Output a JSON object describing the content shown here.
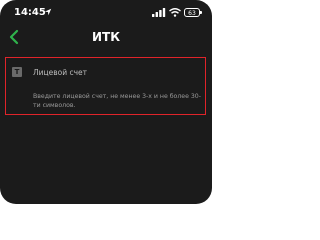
{
  "status_bar": {
    "time": "14:45",
    "battery": "63"
  },
  "header": {
    "title": "ИТК"
  },
  "form": {
    "account_field": {
      "placeholder": "Лицевой счет",
      "icon_letter": "T",
      "hint": "Введите лицевой счет, не менее 3-х и не более 30-ти символов."
    }
  },
  "colors": {
    "background": "#1b1b1b",
    "accent": "#2fb24c",
    "highlight_border": "#e0242a",
    "text_primary": "#ffffff",
    "text_secondary": "#9a9a9a"
  },
  "icons": {
    "status": [
      "location-arrow-icon",
      "signal-icon",
      "wifi-icon",
      "battery-icon"
    ],
    "back": "chevron-left-icon",
    "field": "text-field-icon"
  }
}
